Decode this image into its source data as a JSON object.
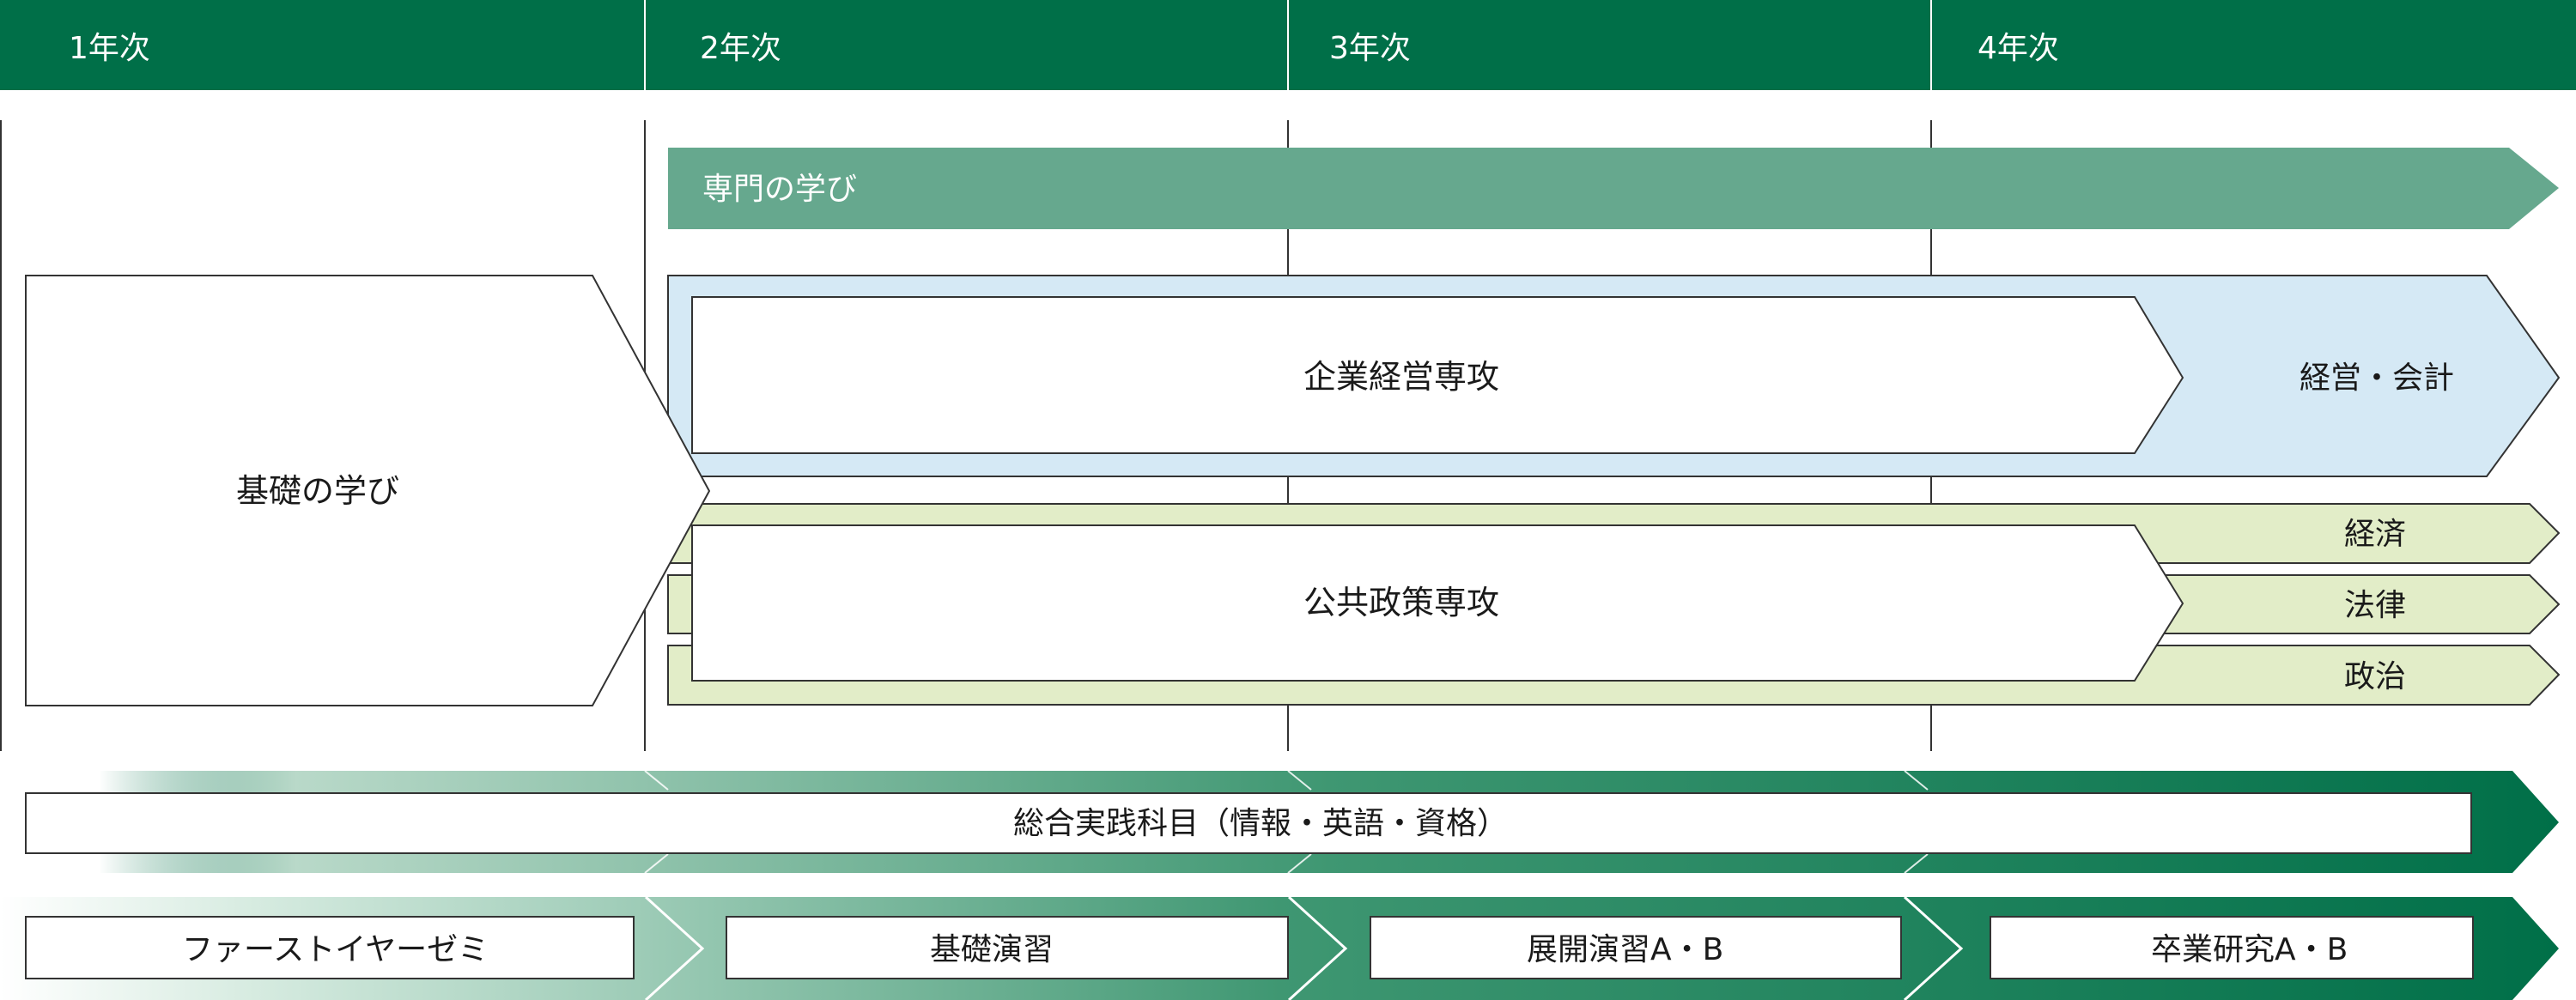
{
  "years": [
    "1年次",
    "2年次",
    "3年次",
    "4年次"
  ],
  "senmon_label": "専門の学び",
  "kiso_label": "基礎の学び",
  "kigyo": {
    "label": "企業経営専攻",
    "tail": "経営・会計"
  },
  "kokyo": {
    "label": "公共政策専攻",
    "tails": [
      "経済",
      "法律",
      "政治"
    ]
  },
  "sogo_label": "総合実践科目（情報・英語・資格）",
  "seminars": [
    "ファーストイヤーゼミ",
    "基礎演習",
    "展開演習A・B",
    "卒業研究A・B"
  ],
  "colors": {
    "header_green": "#006f48",
    "senmon_green": "#66a88e",
    "kigyo_blue": "#d5e9f5",
    "kokyo_green": "#e2edc8",
    "dark_green": "#006f48"
  }
}
